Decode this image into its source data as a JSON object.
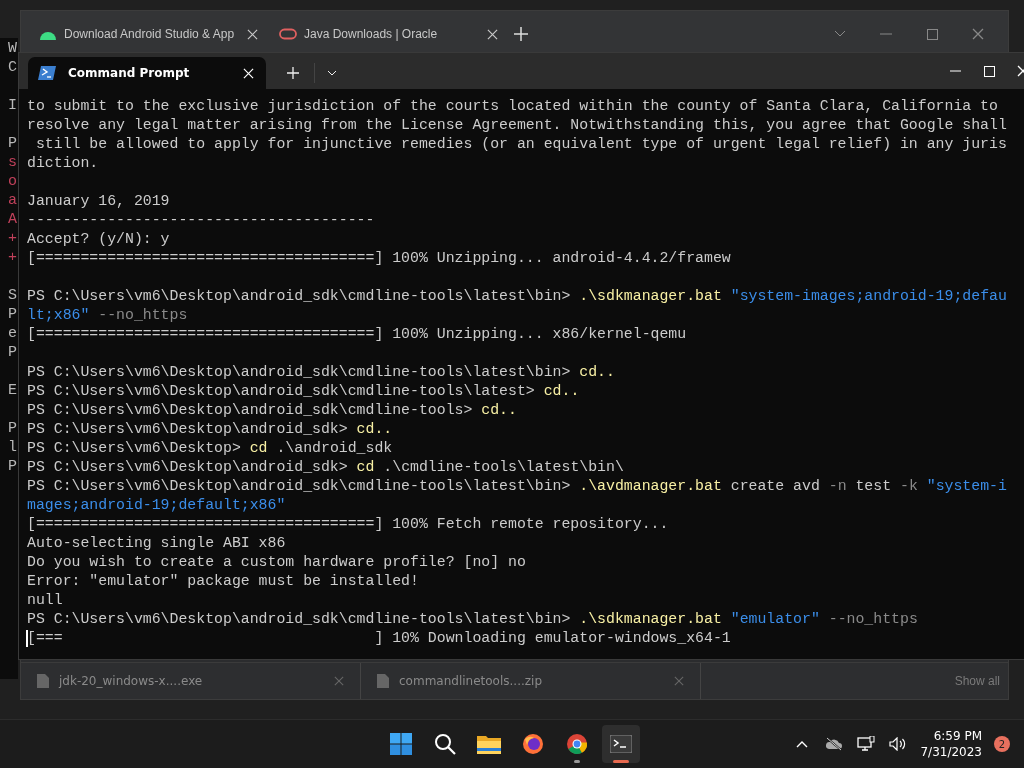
{
  "background_terminal": {
    "blocks": [
      [
        {
          "kind": "plain",
          "text": "W"
        },
        {
          "kind": "plain",
          "text": "C"
        }
      ],
      [
        {
          "kind": "plain",
          "text": "I"
        }
      ],
      [
        {
          "kind": "plain",
          "text": "P"
        },
        {
          "kind": "error",
          "text": "s"
        },
        {
          "kind": "error",
          "text": "o"
        },
        {
          "kind": "error",
          "text": "a"
        },
        {
          "kind": "error",
          "text": "A"
        },
        {
          "kind": "error",
          "text": "+"
        },
        {
          "kind": "error",
          "text": "+"
        }
      ],
      [
        {
          "kind": "plain",
          "text": "S"
        },
        {
          "kind": "plain",
          "text": "P"
        },
        {
          "kind": "plain",
          "text": "e"
        },
        {
          "kind": "plain",
          "text": "P"
        }
      ],
      [
        {
          "kind": "plain",
          "text": "E"
        }
      ],
      [
        {
          "kind": "plain",
          "text": "P"
        },
        {
          "kind": "plain",
          "text": "l"
        },
        {
          "kind": "plain",
          "text": "P"
        }
      ]
    ]
  },
  "browser": {
    "tabs": [
      {
        "label": "Download Android Studio & App",
        "kind": "android",
        "selected": false
      },
      {
        "label": "Java Downloads | Oracle",
        "kind": "oracle",
        "selected": false
      }
    ],
    "downloads": [
      {
        "name": "jdk-20_windows-x....exe"
      },
      {
        "name": "commandlinetools....zip"
      }
    ],
    "show_all": "Show all"
  },
  "terminal": {
    "tabs": [
      {
        "label": "Command Prompt",
        "selected": true
      }
    ],
    "cursor": true,
    "blocks": [
      [
        [
          {
            "kind": "plain",
            "text": "to submit to the exclusive jurisdiction of the courts located within the county of Santa Clara, California to"
          }
        ],
        [
          {
            "kind": "plain",
            "text": "resolve any legal matter arising from the License Agreement. Notwithstanding this, you agree that Google shall"
          }
        ],
        [
          {
            "kind": "plain",
            "text": " still be allowed to apply for injunctive remedies (or an equivalent type of urgent legal relief) in any juris"
          }
        ],
        [
          {
            "kind": "plain",
            "text": "diction."
          }
        ]
      ],
      [
        [
          {
            "kind": "plain",
            "text": "January 16, 2019"
          }
        ],
        [
          {
            "kind": "plain",
            "text": "---------------------------------------"
          }
        ],
        [
          {
            "kind": "plain",
            "text": "Accept? (y/N): y"
          }
        ],
        [
          {
            "kind": "plain",
            "text": "[======================================] 100% Unzipping... android-4.4.2/framew"
          }
        ]
      ],
      [
        [
          {
            "kind": "plain",
            "text": "PS C:\\Users\\vm6\\Desktop\\android_sdk\\cmdline-tools\\latest\\bin> "
          },
          {
            "kind": "command",
            "text": ".\\sdkmanager.bat"
          },
          {
            "kind": "string",
            "text": " \"system-images;android-19;defau"
          }
        ],
        [
          {
            "kind": "string",
            "text": "lt;x86\""
          },
          {
            "kind": "param",
            "text": " --no_https"
          }
        ],
        [
          {
            "kind": "plain",
            "text": "[======================================] 100% Unzipping... x86/kernel-qemu"
          }
        ]
      ],
      [
        [
          {
            "kind": "plain",
            "text": "PS C:\\Users\\vm6\\Desktop\\android_sdk\\cmdline-tools\\latest\\bin> "
          },
          {
            "kind": "command",
            "text": "cd.."
          }
        ],
        [
          {
            "kind": "plain",
            "text": "PS C:\\Users\\vm6\\Desktop\\android_sdk\\cmdline-tools\\latest> "
          },
          {
            "kind": "command",
            "text": "cd.."
          }
        ],
        [
          {
            "kind": "plain",
            "text": "PS C:\\Users\\vm6\\Desktop\\android_sdk\\cmdline-tools> "
          },
          {
            "kind": "command",
            "text": "cd.."
          }
        ],
        [
          {
            "kind": "plain",
            "text": "PS C:\\Users\\vm6\\Desktop\\android_sdk> "
          },
          {
            "kind": "command",
            "text": "cd.."
          }
        ],
        [
          {
            "kind": "plain",
            "text": "PS C:\\Users\\vm6\\Desktop> "
          },
          {
            "kind": "command",
            "text": "cd"
          },
          {
            "kind": "plain",
            "text": " .\\android_sdk"
          }
        ],
        [
          {
            "kind": "plain",
            "text": "PS C:\\Users\\vm6\\Desktop\\android_sdk> "
          },
          {
            "kind": "command",
            "text": "cd"
          },
          {
            "kind": "plain",
            "text": " .\\cmdline-tools\\latest\\bin\\"
          }
        ],
        [
          {
            "kind": "plain",
            "text": "PS C:\\Users\\vm6\\Desktop\\android_sdk\\cmdline-tools\\latest\\bin> "
          },
          {
            "kind": "command",
            "text": ".\\avdmanager.bat"
          },
          {
            "kind": "plain",
            "text": " create avd "
          },
          {
            "kind": "param",
            "text": "-n"
          },
          {
            "kind": "plain",
            "text": " test "
          },
          {
            "kind": "param",
            "text": "-k"
          },
          {
            "kind": "string",
            "text": " \"system-i"
          }
        ],
        [
          {
            "kind": "string",
            "text": "mages;android-19;default;x86\""
          }
        ],
        [
          {
            "kind": "plain",
            "text": "[======================================] 100% Fetch remote repository..."
          }
        ],
        [
          {
            "kind": "plain",
            "text": "Auto-selecting single ABI x86"
          }
        ],
        [
          {
            "kind": "plain",
            "text": "Do you wish to create a custom hardware profile? [no] no"
          }
        ],
        [
          {
            "kind": "plain",
            "text": "Error: \"emulator\" package must be installed!"
          }
        ],
        [
          {
            "kind": "plain",
            "text": "null"
          }
        ],
        [
          {
            "kind": "plain",
            "text": "PS C:\\Users\\vm6\\Desktop\\android_sdk\\cmdline-tools\\latest\\bin> "
          },
          {
            "kind": "command",
            "text": ".\\sdkmanager.bat"
          },
          {
            "kind": "string",
            "text": " \"emulator\""
          },
          {
            "kind": "param",
            "text": " --no_https"
          }
        ],
        [
          {
            "kind": "plain",
            "text": "[===                                   ] 10% Downloading emulator-windows_x64-1"
          }
        ]
      ]
    ]
  },
  "taskbar": {
    "apps": [
      {
        "kind": "start",
        "running": false,
        "active": false
      },
      {
        "kind": "search",
        "running": false,
        "active": false
      },
      {
        "kind": "folder",
        "running": false,
        "active": false
      },
      {
        "kind": "firefox",
        "running": false,
        "active": false
      },
      {
        "kind": "chrome",
        "running": true,
        "active": false
      },
      {
        "kind": "terminal",
        "running": true,
        "active": true
      }
    ],
    "time": "6:59 PM",
    "date": "7/31/2023",
    "notifications": "2"
  }
}
